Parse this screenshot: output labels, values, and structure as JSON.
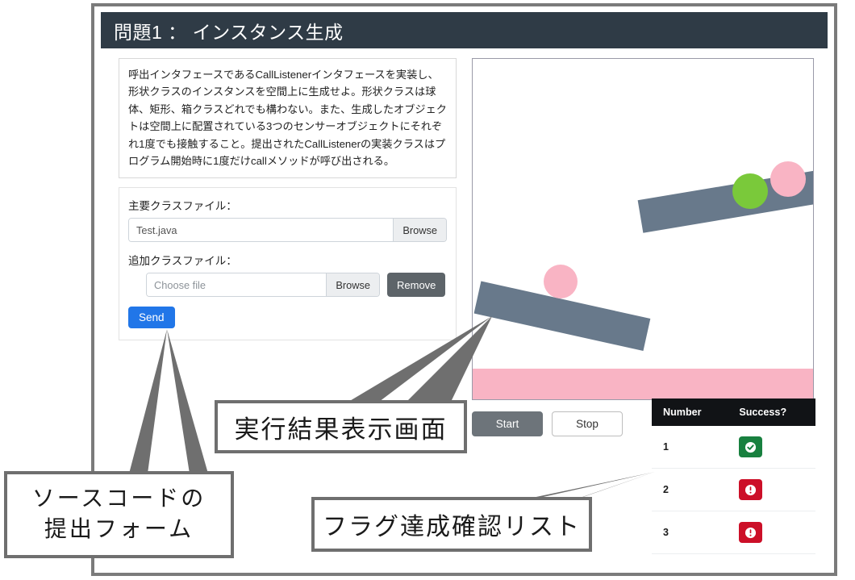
{
  "window": {
    "title": "問題1 ： インスタンス生成"
  },
  "description": {
    "text": "呼出インタフェースであるCallListenerインタフェースを実装し、形状クラスのインスタンスを空間上に生成せよ。形状クラスは球体、矩形、箱クラスどれでも構わない。また、生成したオブジェクトは空間上に配置されている3つのセンサーオブジェクトにそれぞれ1度でも接触すること。提出されたCallListenerの実装クラスはプログラム開始時に1度だけcallメソッドが呼び出される。"
  },
  "form": {
    "main_label": "主要クラスファイル：",
    "main_file_value": "Test.java",
    "main_browse_label": "Browse",
    "extra_label": "追加クラスファイル：",
    "extra_file_placeholder": "Choose file",
    "extra_browse_label": "Browse",
    "remove_label": "Remove",
    "send_label": "Send"
  },
  "simulation": {
    "start_label": "Start",
    "stop_label": "Stop",
    "colors": {
      "bar": "#68798b",
      "floor": "#f9b4c4",
      "circle_pink": "#f9b4c4",
      "circle_green": "#7ac93a"
    },
    "objects": [
      {
        "name": "upper-bar",
        "type": "bar"
      },
      {
        "name": "lower-bar",
        "type": "bar"
      },
      {
        "name": "green-ball",
        "type": "circle",
        "color": "#7ac93a"
      },
      {
        "name": "pink-ball-upper",
        "type": "circle",
        "color": "#f9b4c4"
      },
      {
        "name": "pink-ball-lower",
        "type": "circle",
        "color": "#f9b4c4"
      },
      {
        "name": "floor-strip",
        "type": "bar",
        "color": "#f9b4c4"
      }
    ]
  },
  "results": {
    "columns": [
      "Number",
      "Success?"
    ],
    "rows": [
      {
        "number": "1",
        "success": true,
        "icon": "check-circle-icon"
      },
      {
        "number": "2",
        "success": false,
        "icon": "exclamation-circle-icon"
      },
      {
        "number": "3",
        "success": false,
        "icon": "exclamation-circle-icon"
      }
    ]
  },
  "annotations": {
    "result_screen": "実行結果表示画面",
    "form_line1": "ソースコードの",
    "form_line2": "提出フォーム",
    "flag_list": "フラグ達成確認リスト"
  },
  "theme": {
    "title_bar": "#2f3b46",
    "send_blue": "#2176e8",
    "remove_gray": "#5d6469",
    "start_gray": "#6d747a",
    "badge_green": "#18803f",
    "badge_red": "#cc0f28",
    "callout_border": "#6f6f6f"
  }
}
